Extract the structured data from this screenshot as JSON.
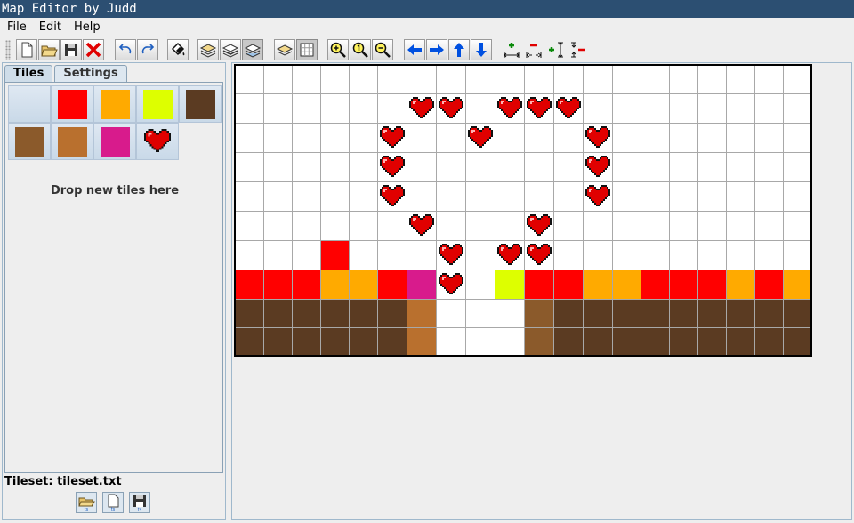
{
  "window": {
    "title": "Map Editor by Judd"
  },
  "menus": [
    "File",
    "Edit",
    "Help"
  ],
  "toolbar": {
    "buttons": [
      {
        "name": "new-map-button",
        "icon": "new-document-icon"
      },
      {
        "name": "open-map-button",
        "icon": "open-folder-icon"
      },
      {
        "name": "save-map-button",
        "icon": "save-disk-icon"
      },
      {
        "name": "close-map-button",
        "icon": "red-x-icon"
      },
      {
        "name": "undo-button",
        "icon": "undo-arrow-icon"
      },
      {
        "name": "redo-button",
        "icon": "redo-arrow-icon"
      },
      {
        "name": "fill-button",
        "icon": "paint-bucket-icon"
      },
      {
        "name": "layer-1-button",
        "icon": "layers-icon"
      },
      {
        "name": "layer-2-button",
        "icon": "layers-icon"
      },
      {
        "name": "layer-3-button",
        "icon": "layers-icon"
      },
      {
        "name": "show-layer-button",
        "icon": "layer-view-icon"
      },
      {
        "name": "grid-toggle-button",
        "icon": "grid-icon"
      },
      {
        "name": "zoom-in-button",
        "icon": "zoom-in-icon"
      },
      {
        "name": "zoom-reset-button",
        "icon": "zoom-reset-icon"
      },
      {
        "name": "zoom-out-button",
        "icon": "zoom-out-icon"
      },
      {
        "name": "shift-left-button",
        "icon": "arrow-left-icon"
      },
      {
        "name": "shift-right-button",
        "icon": "arrow-right-icon"
      },
      {
        "name": "shift-up-button",
        "icon": "arrow-up-icon"
      },
      {
        "name": "shift-down-button",
        "icon": "arrow-down-icon"
      },
      {
        "name": "add-column-button",
        "icon": "add-column-icon"
      },
      {
        "name": "remove-column-button",
        "icon": "remove-column-icon"
      },
      {
        "name": "add-row-button",
        "icon": "add-row-icon"
      },
      {
        "name": "remove-row-button",
        "icon": "remove-row-icon"
      }
    ]
  },
  "sidebar": {
    "tabs": [
      "Tiles",
      "Settings"
    ],
    "active_tab": "Tiles",
    "drop_hint": "Drop new tiles here",
    "tileset_label": "Tileset: tileset.txt",
    "tileset_buttons": [
      {
        "name": "load-tileset-button",
        "icon": "open-tileset-icon"
      },
      {
        "name": "new-tileset-button",
        "icon": "new-tileset-icon"
      },
      {
        "name": "save-tileset-button",
        "icon": "save-tileset-icon"
      }
    ],
    "palette": [
      "empty",
      "red",
      "orange",
      "yellow",
      "dark_brown",
      "brown",
      "light_brown",
      "magenta",
      "heart"
    ]
  },
  "colors": {
    "empty": "#ffffff",
    "red": "#ff0000",
    "orange": "#ffaa00",
    "yellow": "#ddff00",
    "dark_brown": "#5b3b22",
    "brown": "#8b5a2b",
    "light_brown": "#b9702e",
    "magenta": "#d81b8c",
    "heart": "#e00000",
    "titlebar": "#2c4f72"
  },
  "map": {
    "legend": {
      ".": "empty",
      "R": "red",
      "O": "orange",
      "Y": "yellow",
      "D": "dark_brown",
      "B": "brown",
      "L": "light_brown",
      "M": "magenta",
      "H": "heart"
    },
    "rows": [
      "....................",
      "......HH.HHH........",
      ".....H..H...H.......",
      ".....H......H.......",
      ".....H......H.......",
      "......H...H.........",
      "...R...H.HH.........",
      "RRROORMH.YRROORRROR O",
      "DDDDDDL...BDDDDDDDDD",
      "DDDDDDL...BDDDDDDDDD"
    ]
  }
}
